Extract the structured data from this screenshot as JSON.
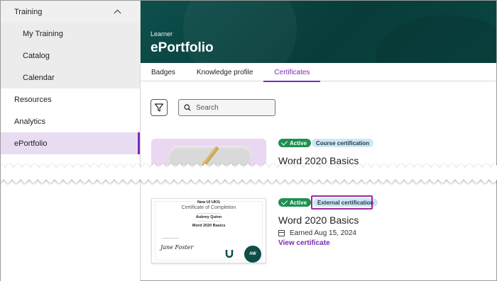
{
  "sidebar": {
    "group_label": "Training",
    "sub_items": [
      {
        "label": "My Training"
      },
      {
        "label": "Catalog"
      },
      {
        "label": "Calendar"
      }
    ],
    "items": [
      {
        "label": "Resources"
      },
      {
        "label": "Analytics"
      },
      {
        "label": "ePortfolio"
      }
    ]
  },
  "header": {
    "eyebrow": "Learner",
    "title": "ePortfolio"
  },
  "tabs": [
    {
      "label": "Badges"
    },
    {
      "label": "Knowledge profile"
    },
    {
      "label": "Certificates"
    }
  ],
  "toolbar": {
    "search_placeholder": "Search"
  },
  "cards": [
    {
      "status": "Active",
      "type": "Course certification",
      "title": "Word 2020 Basics"
    },
    {
      "status": "Active",
      "type": "External certification",
      "title": "Word 2020 Basics",
      "earned": "Earned Aug 15, 2024",
      "link": "View certificate",
      "certificate": {
        "org": "New UI UKG",
        "heading": "Certificate of Completion",
        "recipient": "Aubrey Quinn",
        "course": "Word 2020 Basics",
        "signature": "Jane Foster",
        "seal": "AW"
      }
    }
  ],
  "colors": {
    "accent": "#7a2bb5",
    "header_bg": "#0a4542",
    "active_badge": "#1f8f52",
    "type_badge": "#cfe6f3",
    "highlight": "#9b2aa0"
  }
}
